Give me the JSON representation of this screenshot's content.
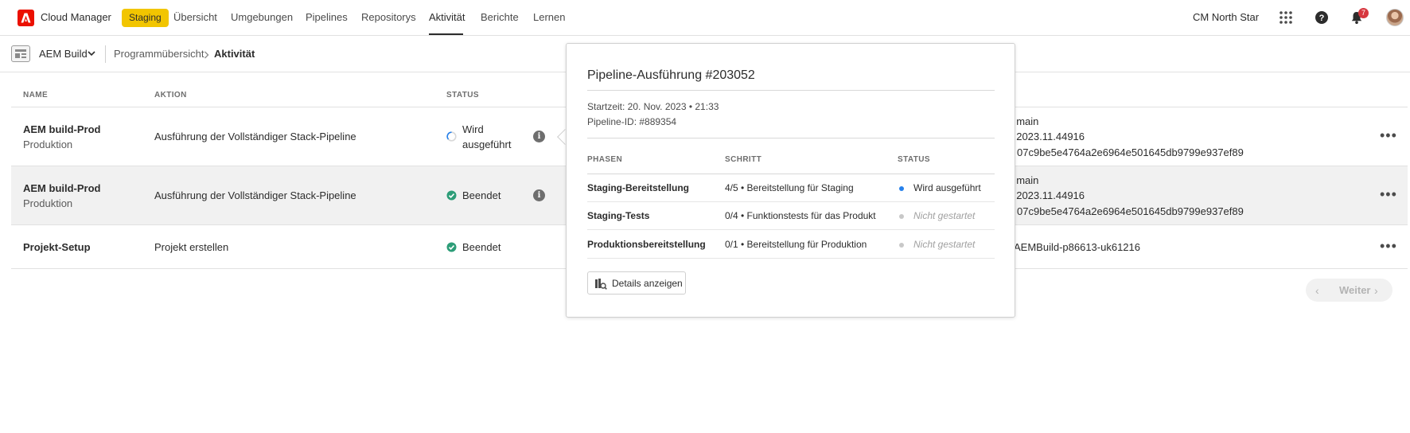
{
  "nav": {
    "brand": "Cloud Manager",
    "env_badge": "Staging",
    "items": [
      "Übersicht",
      "Umgebungen",
      "Pipelines",
      "Repositorys",
      "Aktivität",
      "Berichte",
      "Lernen"
    ],
    "active_item": "Aktivität",
    "org_name": "CM North Star",
    "notification_count": "7",
    "icons": [
      "apps-grid-icon",
      "help-icon",
      "bell-icon",
      "avatar"
    ]
  },
  "subbar": {
    "program_name": "AEM Build",
    "breadcrumb": [
      "Programmübersicht",
      "Aktivität"
    ]
  },
  "table": {
    "headers": {
      "name": "NAME",
      "action": "AKTION",
      "status": "STATUS"
    },
    "rows": [
      {
        "name": "AEM build-Prod",
        "sub": "Produktion",
        "action": "Ausführung der Vollständiger Stack-Pipeline",
        "status_line1": "Wird",
        "status_line2": "ausgeführt",
        "status_type": "running",
        "details": [
          ": main",
          ": 2023.11.44916",
          "07c9be5e4764a2e6964e501645db9799e937ef89"
        ]
      },
      {
        "name": "AEM build-Prod",
        "sub": "Produktion",
        "action": "Ausführung der Vollständiger Stack-Pipeline",
        "status_line1": "Beendet",
        "status_line2": "",
        "status_type": "finished",
        "details": [
          ": main",
          ": 2023.11.44916",
          "07c9be5e4764a2e6964e501645db9799e937ef89"
        ]
      },
      {
        "name": "Projekt-Setup",
        "sub": "",
        "action": "Projekt erstellen",
        "status_line1": "Beendet",
        "status_line2": "",
        "status_type": "finished",
        "details": [
          "AEMBuild-p86613-uk61216"
        ]
      }
    ]
  },
  "pager": {
    "next_label": "Weiter"
  },
  "popover": {
    "title": "Pipeline-Ausführung #203052",
    "start_time": "Startzeit: 20. Nov. 2023 • 21:33",
    "pipeline_id": "Pipeline-ID: #889354",
    "headers": {
      "phase": "PHASEN",
      "step": "SCHRITT",
      "status": "STATUS"
    },
    "phases": [
      {
        "phase": "Staging-Bereitstellung",
        "step": "4/5 • Bereitstellung für Staging",
        "status": "Wird ausgeführt",
        "state": "running"
      },
      {
        "phase": "Staging-Tests",
        "step": "0/4 • Funktionstests für das Produkt",
        "status": "Nicht gestartet",
        "state": "pending"
      },
      {
        "phase": "Produktionsbereitstellung",
        "step": "0/1 • Bereitstellung für Produktion",
        "status": "Nicht gestartet",
        "state": "pending"
      }
    ],
    "details_button": "Details anzeigen"
  },
  "colors": {
    "accent_badge": "#f2c500",
    "adobe_red": "#eb1000",
    "running_blue": "#2680eb",
    "finished_green": "#2d9d78"
  }
}
